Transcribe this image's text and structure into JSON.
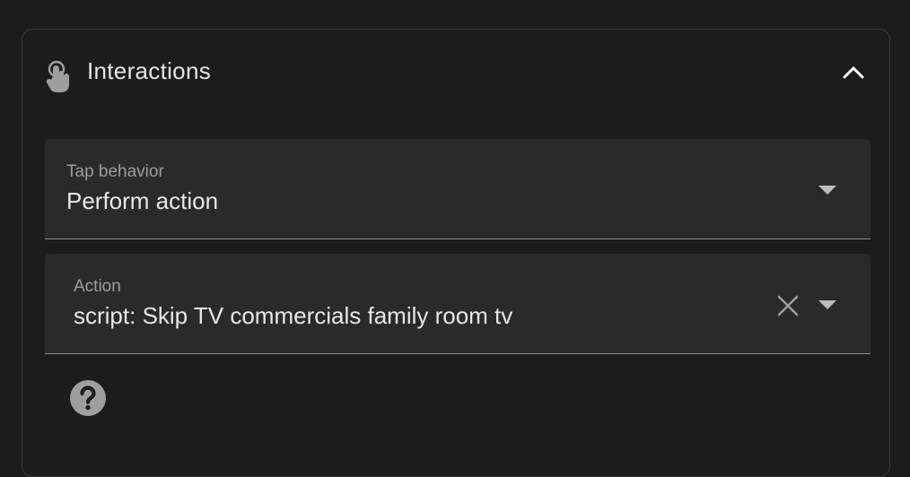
{
  "panel": {
    "title": "Interactions",
    "icon": "gesture-tap-icon",
    "collapse_icon": "chevron-up-icon"
  },
  "tap_behavior": {
    "label": "Tap behavior",
    "value": "Perform action",
    "icon": "dropdown-arrow-icon"
  },
  "action": {
    "label": "Action",
    "value": "script: Skip TV commercials family room tv",
    "clear_icon": "close-icon",
    "dropdown_icon": "dropdown-arrow-icon"
  },
  "help": {
    "icon": "help-circle-icon"
  },
  "colors": {
    "background": "#1c1c1c",
    "field_background": "#2a2a2a",
    "text": "#e8e8e8",
    "label": "#9e9e9e",
    "icon": "#9e9e9e"
  }
}
